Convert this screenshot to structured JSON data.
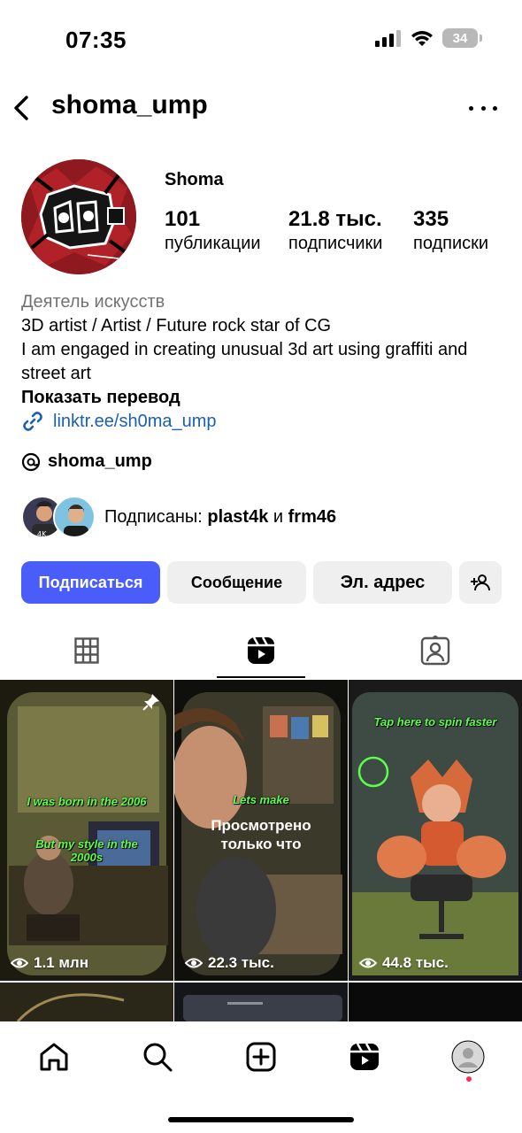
{
  "status": {
    "time": "07:35",
    "battery": "34"
  },
  "header": {
    "username": "shoma_ump"
  },
  "profile": {
    "display_name": "Shoma",
    "stats": [
      {
        "value": "101",
        "label": "публикации"
      },
      {
        "value": "21.8 тыс.",
        "label": "подписчики"
      },
      {
        "value": "335",
        "label": "подписки"
      }
    ],
    "category": "Деятель искусств",
    "bio_line1": "3D artist / Artist / Future rock star of CG",
    "bio_line2": "I am engaged in creating unusual 3d art using graffiti and street art",
    "show_translation": "Показать перевод",
    "link": "linktr.ee/sh0ma_ump",
    "threads_handle": "shoma_ump",
    "followed_prefix": "Подписаны: ",
    "followed_user1": "plast4k",
    "followed_and": " и ",
    "followed_user2": "frm46"
  },
  "actions": {
    "follow": "Подписаться",
    "message": "Сообщение",
    "email": "Эл. адрес"
  },
  "tabs": [
    "grid-icon",
    "reels-icon",
    "tagged-icon"
  ],
  "posts": [
    {
      "views": "1.1 млн",
      "graffiti1": "I was born in the 2006",
      "graffiti2": "But my style in the 2000s",
      "pinned": true
    },
    {
      "views": "22.3 тыс.",
      "graffiti1": "Lets make",
      "overlay": "Просмотрено только что"
    },
    {
      "views": "44.8 тыс.",
      "graffiti1": "Tap here to spin faster"
    }
  ],
  "colors": {
    "primary": "#4a5df9",
    "link": "#1a5fb4",
    "secondary_text": "#737373"
  },
  "nav": [
    "home-icon",
    "search-icon",
    "create-icon",
    "reels-icon",
    "profile-icon"
  ]
}
